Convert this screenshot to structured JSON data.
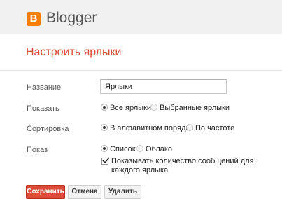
{
  "header": {
    "brand": "Blogger",
    "brand_icon": "blogger-logo-icon",
    "brand_color": "#f57d00"
  },
  "title": "Настроить ярлыки",
  "accent_color": "#dd4b39",
  "form": {
    "name": {
      "label": "Название",
      "value": "Ярлыки"
    },
    "show": {
      "label": "Показать",
      "options": [
        {
          "label": "Все ярлыки",
          "checked": true
        },
        {
          "label": "Выбранные ярлыки",
          "checked": false
        }
      ]
    },
    "sort": {
      "label": "Сортировка",
      "options": [
        {
          "label": "В алфавитном порядке",
          "checked": true
        },
        {
          "label": "По частоте",
          "checked": false
        }
      ]
    },
    "display": {
      "label": "Показ",
      "options": [
        {
          "label": "Список",
          "checked": true
        },
        {
          "label": "Облако",
          "checked": false
        }
      ],
      "count_checkbox": {
        "label": "Показывать количество сообщений для каждого ярлыка",
        "checked": true
      }
    }
  },
  "buttons": {
    "save": "Сохранить",
    "cancel": "Отмена",
    "delete": "Удалить"
  }
}
